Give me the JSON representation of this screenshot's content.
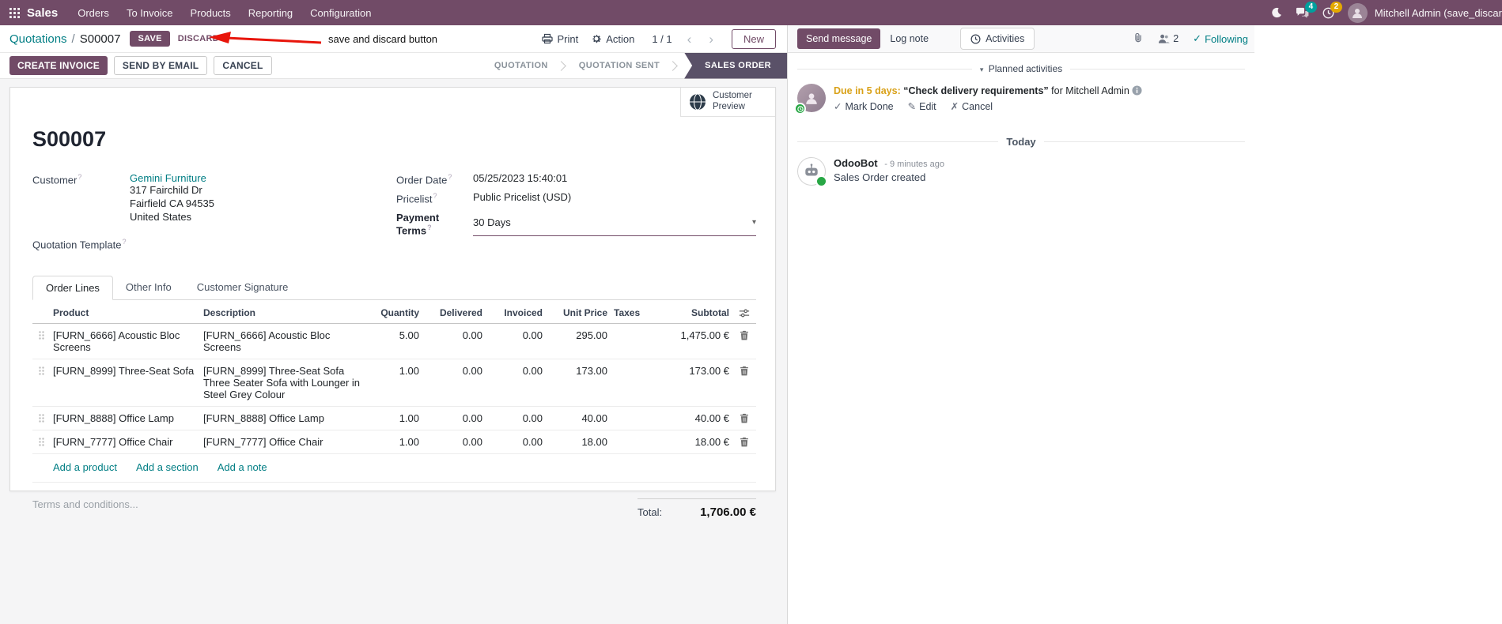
{
  "help_marker": "?",
  "icons": {
    "check": "✓",
    "pencil": "✎",
    "cross": "✗",
    "caret_down": "▾",
    "chevron_left": "‹",
    "chevron_right": "›"
  },
  "colors": {
    "brand": "#714B67",
    "accent": "#017E84",
    "active_state_bg": "#5A5168",
    "annotation_arrow": "#E8150B",
    "due_warning": "#D9A118",
    "changed_value": "#2779B0"
  },
  "navbar": {
    "brand": "Sales",
    "menus": [
      "Orders",
      "To Invoice",
      "Products",
      "Reporting",
      "Configuration"
    ],
    "messages_badge": "4",
    "activities_badge": "2",
    "user_name": "Mitchell Admin (save_discar"
  },
  "control_panel": {
    "breadcrumb_parent": "Quotations",
    "breadcrumb_sep": "/",
    "breadcrumb_current": "S00007",
    "save": "SAVE",
    "discard": "DISCARD",
    "annotation": "save and discard button",
    "print": "Print",
    "action": "Action",
    "pager": "1 / 1",
    "new": "New"
  },
  "statusbar": {
    "create_invoice": "CREATE INVOICE",
    "send_by_email": "SEND BY EMAIL",
    "cancel": "CANCEL",
    "states": [
      "QUOTATION",
      "QUOTATION SENT",
      "SALES ORDER"
    ],
    "active_state": "SALES ORDER"
  },
  "sheet": {
    "customer_preview": "Customer Preview",
    "title": "S00007",
    "customer_label": "Customer",
    "customer_name": "Gemini Furniture",
    "address_line1": "317 Fairchild Dr",
    "address_line2": "Fairfield CA 94535",
    "address_line3": "United States",
    "quotation_template_label": "Quotation Template",
    "order_date_label": "Order Date",
    "order_date": "05/25/2023 15:40:01",
    "pricelist_label": "Pricelist",
    "pricelist": "Public Pricelist (USD)",
    "payment_terms_label": "Payment Terms",
    "payment_terms": "30 Days",
    "tabs": [
      "Order Lines",
      "Other Info",
      "Customer Signature"
    ],
    "table": {
      "headers": [
        "Product",
        "Description",
        "Quantity",
        "Delivered",
        "Invoiced",
        "Unit Price",
        "Taxes",
        "Subtotal"
      ],
      "rows": [
        {
          "product": "[FURN_6666] Acoustic Bloc Screens",
          "desc1": "[FURN_6666] Acoustic Bloc Screens",
          "desc2": "",
          "qty": "5.00",
          "delivered": "0.00",
          "invoiced": "0.00",
          "price": "295.00",
          "taxes": "",
          "subtotal": "1,475.00 €"
        },
        {
          "product": "[FURN_8999] Three-Seat Sofa",
          "desc1": "[FURN_8999] Three-Seat Sofa",
          "desc2": "Three Seater Sofa with Lounger in Steel Grey Colour",
          "qty": "1.00",
          "delivered": "0.00",
          "invoiced": "0.00",
          "price": "173.00",
          "taxes": "",
          "subtotal": "173.00 €"
        },
        {
          "product": "[FURN_8888] Office Lamp",
          "desc1": "[FURN_8888] Office Lamp",
          "desc2": "",
          "qty": "1.00",
          "delivered": "0.00",
          "invoiced": "0.00",
          "price": "40.00",
          "taxes": "",
          "subtotal": "40.00 €"
        },
        {
          "product": "[FURN_7777] Office Chair",
          "desc1": "[FURN_7777] Office Chair",
          "desc2": "",
          "qty": "1.00",
          "delivered": "0.00",
          "invoiced": "0.00",
          "price": "18.00",
          "taxes": "",
          "subtotal": "18.00 €"
        }
      ],
      "add_product": "Add a product",
      "add_section": "Add a section",
      "add_note": "Add a note"
    },
    "terms_placeholder": "Terms and conditions...",
    "total_label": "Total:",
    "total_value": "1,706.00 €"
  },
  "chatter": {
    "send_message": "Send message",
    "log_note": "Log note",
    "activities_tab": "Activities",
    "followers_count": "2",
    "following": "Following",
    "planned_header": "Planned activities",
    "activity": {
      "due": "Due in 5 days:",
      "summary": "“Check delivery requirements”",
      "assignee": "for Mitchell Admin",
      "mark_done": "Mark Done",
      "edit": "Edit",
      "cancel": "Cancel"
    },
    "date_divider": "Today",
    "message": {
      "author": "OdooBot",
      "time": "- 9 minutes ago",
      "body": "Sales Order created"
    }
  }
}
